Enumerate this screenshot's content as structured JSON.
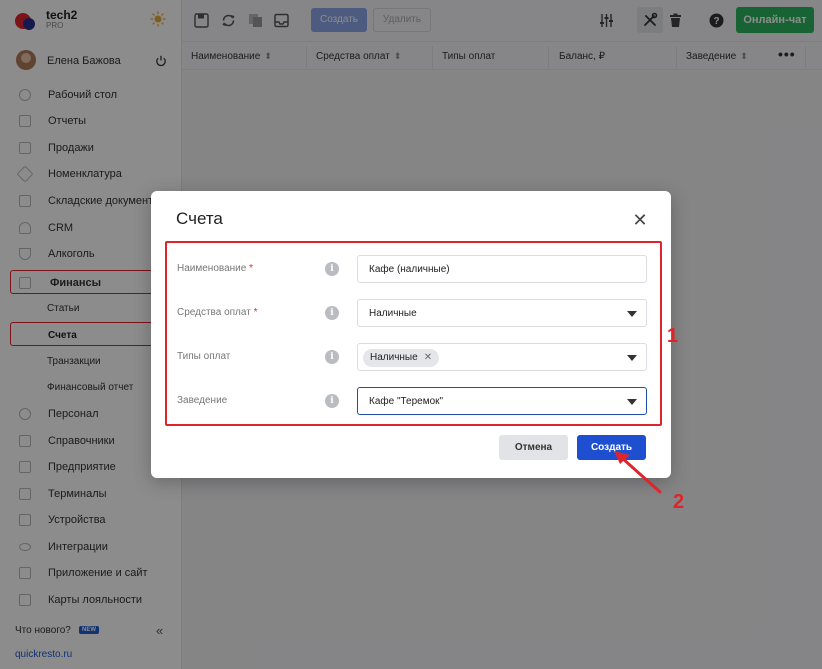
{
  "brand": {
    "name": "tech2",
    "sub": "PRO"
  },
  "user": {
    "name": "Елена Бажова"
  },
  "nav": {
    "desktop": "Рабочий стол",
    "reports": "Отчеты",
    "sales": "Продажи",
    "nomenclature": "Номенклатура",
    "warehouse": "Складские документы",
    "crm": "CRM",
    "alcohol": "Алкоголь",
    "finance": "Финансы",
    "articles": "Статьи",
    "accounts": "Счета",
    "transactions": "Транзакции",
    "finreport": "Финансовый отчет",
    "personnel": "Персонал",
    "directories": "Справочники",
    "enterprise": "Предприятие",
    "terminals": "Терминалы",
    "devices": "Устройства",
    "integrations": "Интеграции",
    "appsite": "Приложение и сайт",
    "loyalty": "Карты лояльности"
  },
  "footer": {
    "whatsnew": "Что нового?",
    "badge": "NEW",
    "link": "quickresto.ru"
  },
  "toolbar": {
    "create": "Создать",
    "delete": "Удалить",
    "chat": "Онлайн-чат"
  },
  "table": {
    "columns": [
      "Наименование",
      "Средства оплат",
      "Типы оплат",
      "Баланс, ₽",
      "Заведение"
    ]
  },
  "modal": {
    "title": "Счета",
    "fields": {
      "name_label": "Наименование",
      "name_value": "Кафе (наличные)",
      "means_label": "Средства оплат",
      "means_value": "Наличные",
      "types_label": "Типы оплат",
      "types_chip": "Наличные",
      "venue_label": "Заведение",
      "venue_value": "Кафе \"Теремок\""
    },
    "required_mark": "*",
    "cancel": "Отмена",
    "submit": "Создать"
  },
  "annotations": {
    "one": "1",
    "two": "2"
  },
  "colors": {
    "accent": "#1f4fd1",
    "chat": "#2db55d",
    "annotation": "#e0242c"
  }
}
